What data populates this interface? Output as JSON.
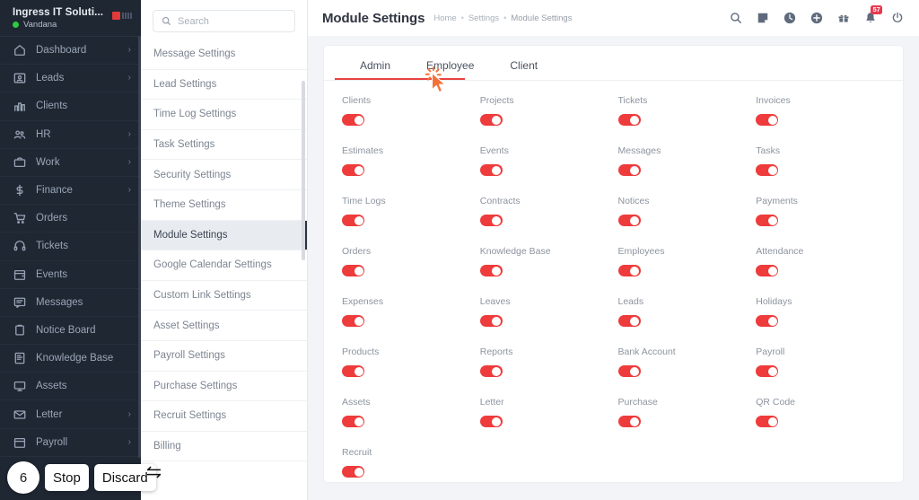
{
  "sidebar": {
    "company": "Ingress IT Soluti...",
    "user": "Vandana",
    "items": [
      {
        "label": "Dashboard",
        "icon": "home-icon",
        "chevron": "›"
      },
      {
        "label": "Leads",
        "icon": "leads-icon",
        "chevron": "›"
      },
      {
        "label": "Clients",
        "icon": "clients-icon",
        "chevron": ""
      },
      {
        "label": "HR",
        "icon": "hr-icon",
        "chevron": "›"
      },
      {
        "label": "Work",
        "icon": "work-icon",
        "chevron": "›"
      },
      {
        "label": "Finance",
        "icon": "finance-icon",
        "chevron": "›"
      },
      {
        "label": "Orders",
        "icon": "orders-icon",
        "chevron": ""
      },
      {
        "label": "Tickets",
        "icon": "tickets-icon",
        "chevron": ""
      },
      {
        "label": "Events",
        "icon": "events-icon",
        "chevron": ""
      },
      {
        "label": "Messages",
        "icon": "messages-icon",
        "chevron": ""
      },
      {
        "label": "Notice Board",
        "icon": "notice-board-icon",
        "chevron": ""
      },
      {
        "label": "Knowledge Base",
        "icon": "knowledge-base-icon",
        "chevron": ""
      },
      {
        "label": "Assets",
        "icon": "assets-icon",
        "chevron": ""
      },
      {
        "label": "Letter",
        "icon": "letter-icon",
        "chevron": "›"
      },
      {
        "label": "Payroll",
        "icon": "payroll-icon",
        "chevron": "›"
      }
    ]
  },
  "settings_panel": {
    "search_placeholder": "Search",
    "search_value": "",
    "items": [
      {
        "label": "Message Settings",
        "active": false
      },
      {
        "label": "Lead Settings",
        "active": false
      },
      {
        "label": "Time Log Settings",
        "active": false
      },
      {
        "label": "Task Settings",
        "active": false
      },
      {
        "label": "Security Settings",
        "active": false
      },
      {
        "label": "Theme Settings",
        "active": false
      },
      {
        "label": "Module Settings",
        "active": true
      },
      {
        "label": "Google Calendar Settings",
        "active": false
      },
      {
        "label": "Custom Link Settings",
        "active": false
      },
      {
        "label": "Asset Settings",
        "active": false
      },
      {
        "label": "Payroll Settings",
        "active": false
      },
      {
        "label": "Purchase Settings",
        "active": false
      },
      {
        "label": "Recruit Settings",
        "active": false
      },
      {
        "label": "Billing",
        "active": false
      }
    ]
  },
  "topbar": {
    "title": "Module Settings",
    "breadcrumb": [
      "Home",
      "Settings",
      "Module Settings"
    ],
    "separator": "•",
    "icons": [
      {
        "name": "search-icon"
      },
      {
        "name": "note-icon"
      },
      {
        "name": "clock-icon"
      },
      {
        "name": "plus-circle-icon"
      },
      {
        "name": "gift-icon"
      },
      {
        "name": "bell-icon",
        "badge": "57"
      },
      {
        "name": "power-icon"
      }
    ]
  },
  "main": {
    "tabs": [
      {
        "label": "Admin",
        "active": false
      },
      {
        "label": "Employee",
        "active": true
      },
      {
        "label": "Client",
        "active": false
      }
    ],
    "accent_color": "#e8433f",
    "toggle_on_color": "#ee3b3b",
    "modules": [
      {
        "label": "Clients",
        "enabled": true
      },
      {
        "label": "Projects",
        "enabled": true
      },
      {
        "label": "Tickets",
        "enabled": true
      },
      {
        "label": "Invoices",
        "enabled": true
      },
      {
        "label": "Estimates",
        "enabled": true
      },
      {
        "label": "Events",
        "enabled": true
      },
      {
        "label": "Messages",
        "enabled": true
      },
      {
        "label": "Tasks",
        "enabled": true
      },
      {
        "label": "Time Logs",
        "enabled": true
      },
      {
        "label": "Contracts",
        "enabled": true
      },
      {
        "label": "Notices",
        "enabled": true
      },
      {
        "label": "Payments",
        "enabled": true
      },
      {
        "label": "Orders",
        "enabled": true
      },
      {
        "label": "Knowledge Base",
        "enabled": true
      },
      {
        "label": "Employees",
        "enabled": true
      },
      {
        "label": "Attendance",
        "enabled": true
      },
      {
        "label": "Expenses",
        "enabled": true
      },
      {
        "label": "Leaves",
        "enabled": true
      },
      {
        "label": "Leads",
        "enabled": true
      },
      {
        "label": "Holidays",
        "enabled": true
      },
      {
        "label": "Products",
        "enabled": true
      },
      {
        "label": "Reports",
        "enabled": true
      },
      {
        "label": "Bank Account",
        "enabled": true
      },
      {
        "label": "Payroll",
        "enabled": true
      },
      {
        "label": "Assets",
        "enabled": true
      },
      {
        "label": "Letter",
        "enabled": true
      },
      {
        "label": "Purchase",
        "enabled": true
      },
      {
        "label": "QR Code",
        "enabled": true
      },
      {
        "label": "Recruit",
        "enabled": true
      }
    ]
  },
  "overlay": {
    "counter": "6",
    "stop_label": "Stop",
    "discard_label": "Discard"
  }
}
